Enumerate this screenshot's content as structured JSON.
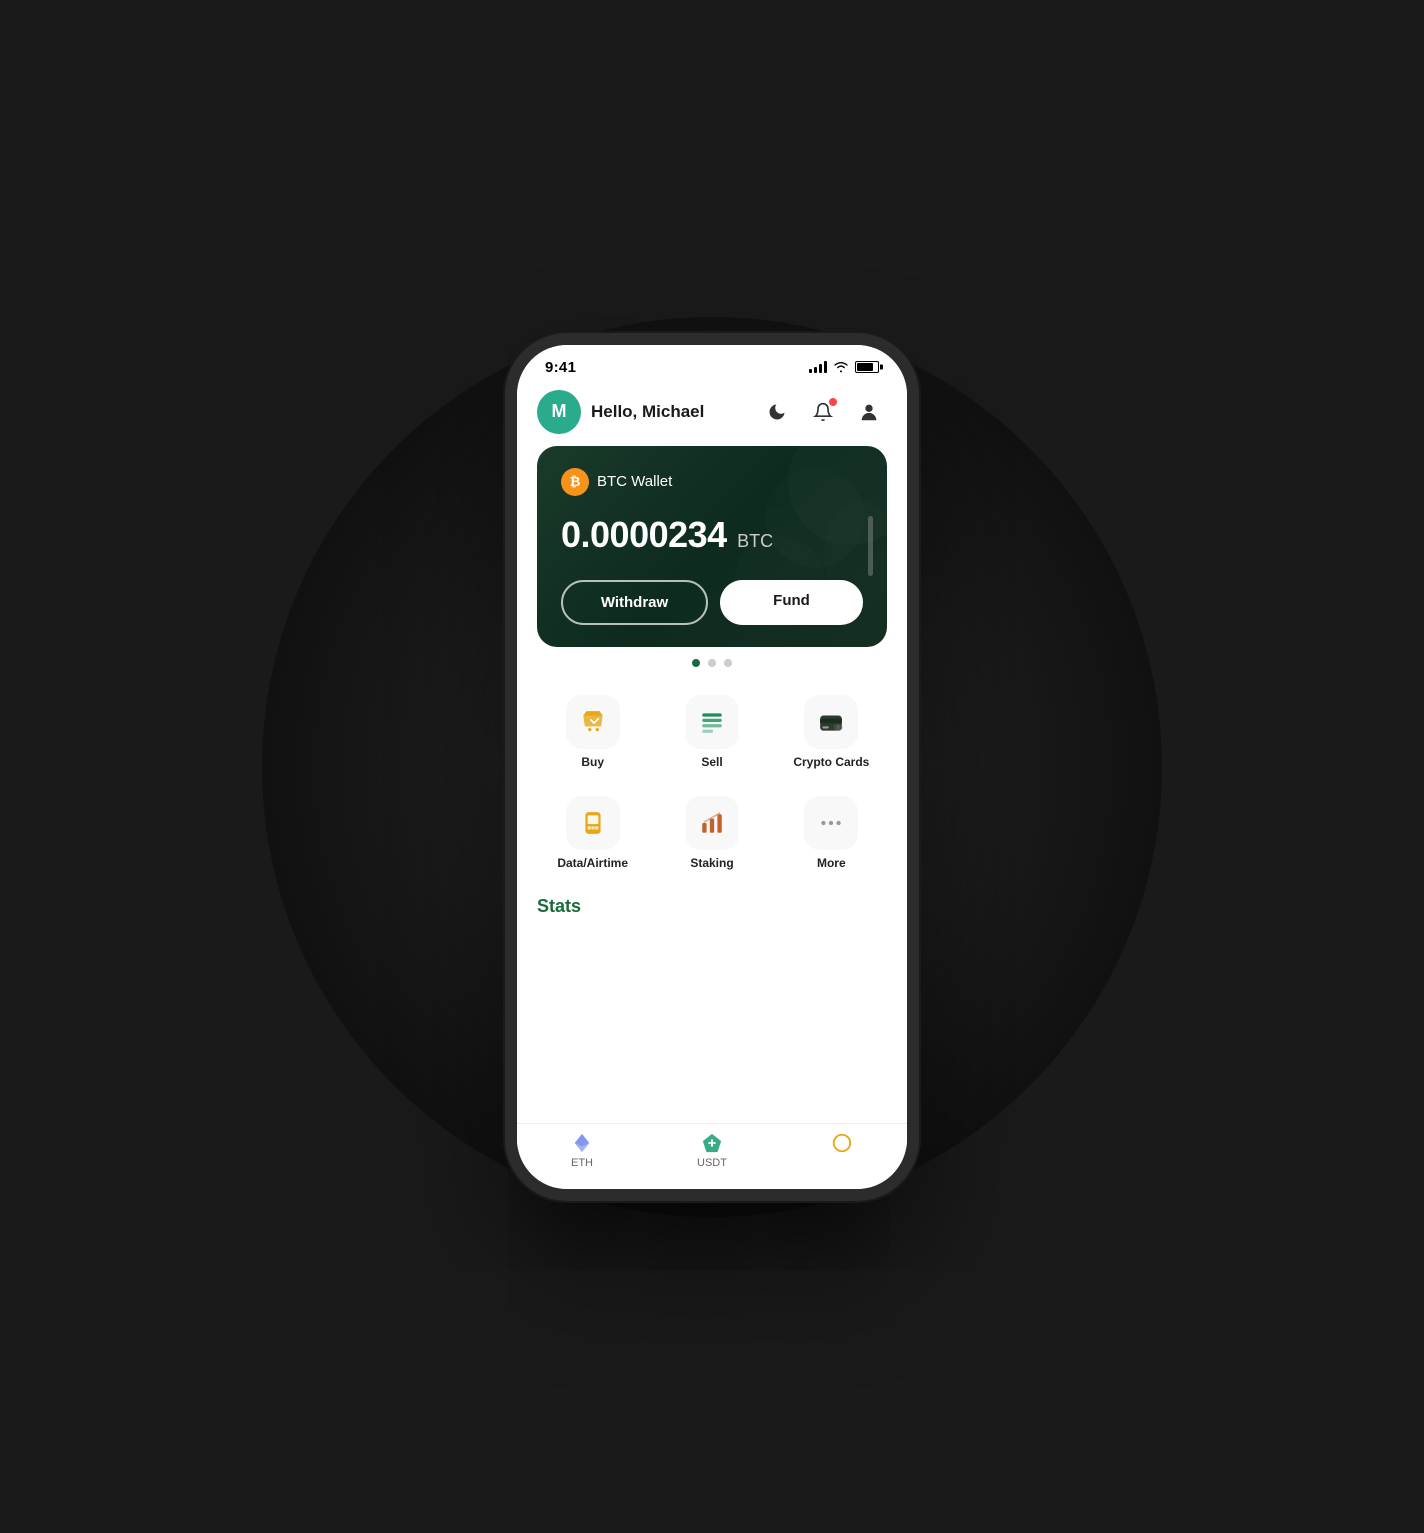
{
  "status_bar": {
    "time": "9:41"
  },
  "header": {
    "avatar_letter": "M",
    "greeting": "Hello, Michael"
  },
  "wallet": {
    "coin_icon": "₿",
    "label": "BTC Wallet",
    "balance": "0.0000234",
    "currency": "BTC",
    "withdraw_btn": "Withdraw",
    "fund_btn": "Fund"
  },
  "slide_dots": [
    {
      "active": true
    },
    {
      "active": false
    },
    {
      "active": false
    }
  ],
  "actions": [
    {
      "id": "buy",
      "label": "Buy",
      "icon": "🛒",
      "icon_type": "buy"
    },
    {
      "id": "sell",
      "label": "Sell",
      "icon": "⚡",
      "icon_type": "sell"
    },
    {
      "id": "crypto-cards",
      "label": "Crypto Cards",
      "icon": "💳",
      "icon_type": "cards"
    },
    {
      "id": "data-airtime",
      "label": "Data/Airtime",
      "icon": "📱",
      "icon_type": "data"
    },
    {
      "id": "staking",
      "label": "Staking",
      "icon": "📊",
      "icon_type": "staking"
    },
    {
      "id": "more",
      "label": "More",
      "icon": "···",
      "icon_type": "more"
    }
  ],
  "stats": {
    "title": "Stats"
  },
  "bottom_nav": [
    {
      "id": "eth",
      "label": "ETH",
      "icon": "◆"
    },
    {
      "id": "usdt",
      "label": "USDT",
      "icon": "◈"
    },
    {
      "id": "other",
      "label": "",
      "icon": "◎"
    }
  ]
}
